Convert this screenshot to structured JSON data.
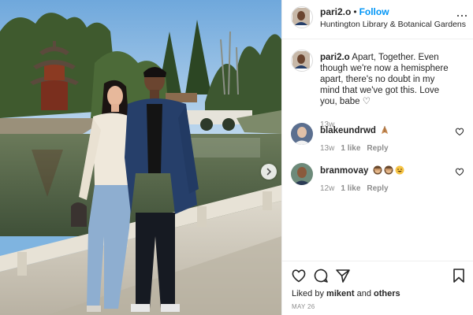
{
  "post": {
    "username": "pari2.o",
    "separator": "•",
    "follow_label": "Follow",
    "location": "Huntington Library & Botanical Gardens",
    "caption_text": "Apart, Together. Even though we're now a hemisphere apart, there's no doubt in my mind that we've got this. Love you, babe ♡",
    "caption_age": "13w"
  },
  "comments": [
    {
      "username": "blakeundrwd",
      "text": "",
      "emoji": [
        "praying-hands"
      ],
      "age": "13w",
      "likes": "1 like",
      "reply_label": "Reply"
    },
    {
      "username": "branmovay",
      "text": "",
      "emoji": [
        "see-no-evil-monkey",
        "see-no-evil-monkey",
        "grinning-face"
      ],
      "age": "12w",
      "likes": "1 like",
      "reply_label": "Reply"
    }
  ],
  "footer": {
    "liked_prefix": "Liked by",
    "liked_user": "mikent",
    "liked_and": "and",
    "liked_others": "others",
    "date": "MAY 26"
  },
  "colors": {
    "link_blue": "#0095f6",
    "text": "#262626",
    "muted": "#8e8e8e",
    "divider": "#efefef"
  },
  "icons": {
    "like": "heart-icon",
    "comment": "comment-bubble-icon",
    "share": "paper-plane-icon",
    "save": "bookmark-icon",
    "more": "ellipsis-icon",
    "next": "chevron-right-icon"
  }
}
